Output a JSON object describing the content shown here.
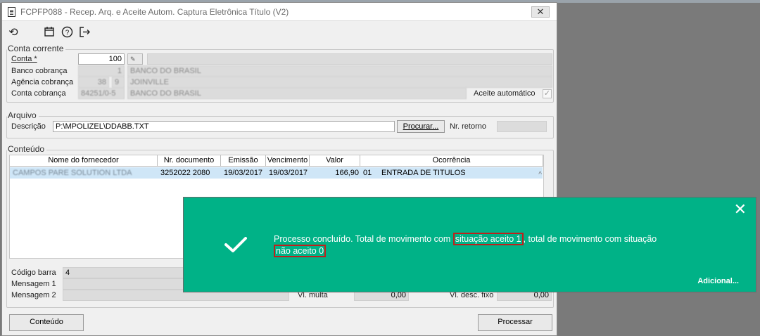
{
  "window": {
    "title": "FCPFP088 - Recep. Arq. e Aceite Autom. Captura Eletrônica Título (V2)",
    "close": "✕"
  },
  "toolbar": {
    "refresh_icon": "⟲",
    "calendar_icon": "📅",
    "help_icon": "?",
    "exit_icon": "⇥"
  },
  "conta_corrente": {
    "title": "Conta corrente",
    "conta_label": "Conta *",
    "conta_value": "100",
    "banco_label": "Banco cobrança",
    "banco_code": "1",
    "banco_name": "BANCO DO BRASIL",
    "agencia_label": "Agência cobrança",
    "agencia_code": "38",
    "agencia_dv": "9",
    "agencia_name": "JOINVILLE",
    "conta_cob_label": "Conta cobrança",
    "conta_cob_value": "84251/0-5",
    "conta_cob_name": "BANCO DO BRASIL",
    "aceite_label": "Aceite automático",
    "aceite_checked": "✓"
  },
  "arquivo": {
    "title": "Arquivo",
    "descricao_label": "Descrição",
    "descricao_value": "P:\\MPOLIZEL\\DDABB.TXT",
    "procurar_label": "Procurar...",
    "nr_retorno_label": "Nr. retorno",
    "nr_retorno_value": ""
  },
  "conteudo": {
    "title": "Conteúdo",
    "columns": [
      "Nome do fornecedor",
      "Nr. documento",
      "Emissão",
      "Vencimento",
      "Valor",
      "Ocorrência"
    ],
    "rows": [
      {
        "fornecedor": "CAMPOS PARE SOLUTION LTDA",
        "documento": "3252022   2080",
        "emissao": "19/03/2017",
        "vencimento": "19/03/2017",
        "valor": "166,90",
        "ocorrencia_code": "01",
        "ocorrencia": "ENTRADA DE TITULOS"
      }
    ],
    "scroll_up": "^",
    "codigo_barra_label": "Código barra",
    "codigo_barra_value": "4",
    "mensagem1_label": "Mensagem 1",
    "mensagem2_label": "Mensagem 2",
    "vl_multa_label": "Vl. multa",
    "vl_multa_value": "0,00",
    "vl_desc_label": "Vl. desc. fixo",
    "vl_desc_value": "0,00"
  },
  "footer": {
    "conteudo_button": "Conteúdo",
    "processar_button": "Processar"
  },
  "toast": {
    "close": "✕",
    "msg_part1": "Processo concluído. Total de movimento com ",
    "highlight1": "situação aceito 1",
    "msg_part2": ",  total de movimento com situação ",
    "highlight2": "não aceito 0",
    "more_link": "Adicional...",
    "bg_color": "#00b287",
    "highlight_color": "#c0201c"
  }
}
